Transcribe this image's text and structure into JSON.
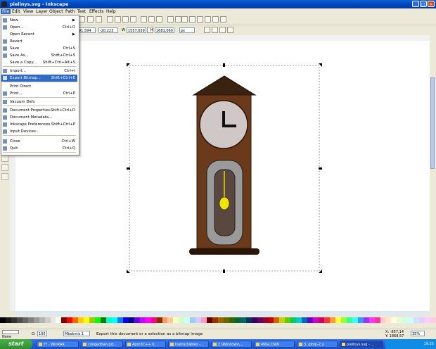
{
  "window": {
    "title": "pielinys.svg - Inkscape",
    "min": "_",
    "max": "□",
    "close": "×"
  },
  "menubar": [
    "File",
    "Edit",
    "View",
    "Layer",
    "Object",
    "Path",
    "Text",
    "Effects",
    "Help"
  ],
  "toolbar2": {
    "x_value": "91,594",
    "y_label": "",
    "y_value": "-20,223",
    "w_label": "W",
    "w_value": "1557,659",
    "h_label": "H",
    "h_value": "1681,060",
    "unit": "px"
  },
  "file_menu": [
    {
      "label": "New",
      "shortcut": "▶",
      "icon": "new-icon"
    },
    {
      "label": "Open...",
      "shortcut": "Ctrl+O",
      "icon": "open-icon"
    },
    {
      "label": "Open Recent",
      "shortcut": "▶",
      "icon": ""
    },
    {
      "label": "Revert",
      "shortcut": "",
      "icon": "revert-icon"
    },
    {
      "label": "Save",
      "shortcut": "Ctrl+S",
      "icon": "save-icon"
    },
    {
      "label": "Save As...",
      "shortcut": "Shift+Ctrl+S",
      "icon": "save-as-icon"
    },
    {
      "label": "Save a Copy...",
      "shortcut": "Shift+Ctrl+Alt+S",
      "icon": ""
    },
    {
      "label": "Import...",
      "shortcut": "Ctrl+I",
      "icon": "import-icon"
    },
    {
      "label": "Export Bitmap...",
      "shortcut": "Shift+Ctrl+E",
      "icon": "export-icon"
    },
    {
      "label": "Print Direct",
      "shortcut": "",
      "icon": ""
    },
    {
      "label": "Print...",
      "shortcut": "Ctrl+P",
      "icon": "print-icon"
    },
    {
      "label": "Vacuum Defs",
      "shortcut": "",
      "icon": "vacuum-icon"
    },
    {
      "label": "Document Properties...",
      "shortcut": "Shift+Ctrl+D",
      "icon": "doc-properties-icon"
    },
    {
      "label": "Document Metadata...",
      "shortcut": "",
      "icon": "metadata-icon"
    },
    {
      "label": "Inkscape Preferences...",
      "shortcut": "Shift+Ctrl+P",
      "icon": "preferences-icon"
    },
    {
      "label": "Input Devices...",
      "shortcut": "",
      "icon": "input-devices-icon"
    },
    {
      "label": "Close",
      "shortcut": "Ctrl+W",
      "icon": "close-icon"
    },
    {
      "label": "Quit",
      "shortcut": "Ctrl+Q",
      "icon": "quit-icon"
    }
  ],
  "status": {
    "opacity_label": "O:",
    "opacity": "100",
    "layer": "Mbokmis 1",
    "message": "Export this document or a selection as a bitmap image",
    "coords_x": "X: -857,14",
    "coords_y": "Y: 1868,57",
    "zoom": "35%",
    "none_label": "None"
  },
  "taskbar": {
    "start": "start",
    "tasks": [
      "?? - WinRAR",
      "congedhan.pd...",
      "Apro3C++ 0...",
      "Instructables -...",
      "Z:\\Windows\\...",
      "4NGLCNIN",
      "3. gimp-2.2",
      "pielinys.svg - ..."
    ],
    "clock": "19:25"
  },
  "palette": [
    "#000000",
    "#1a1a1a",
    "#333333",
    "#4d4d4d",
    "#666666",
    "#808080",
    "#999999",
    "#b3b3b3",
    "#cccccc",
    "#e6e6e6",
    "#ffffff",
    "#800000",
    "#ff0000",
    "#ff6600",
    "#ffcc00",
    "#ffff00",
    "#99cc00",
    "#00ff00",
    "#008000",
    "#00ffcc",
    "#00ffff",
    "#0080ff",
    "#0000ff",
    "#000080",
    "#6600ff",
    "#cc00ff",
    "#ff00ff",
    "#ff0080",
    "#803300",
    "#ff9966",
    "#ffcc99",
    "#ffffcc",
    "#ccffcc",
    "#ccffff",
    "#99ccff",
    "#ccccff",
    "#ff99cc",
    "#660000",
    "#993300",
    "#996600",
    "#666600",
    "#336600",
    "#006633",
    "#006666",
    "#003366",
    "#330066",
    "#660066",
    "#990033",
    "#cc0000",
    "#cc6600",
    "#cccc00",
    "#66cc00",
    "#00cc66",
    "#00cccc",
    "#0066cc",
    "#6600cc",
    "#cc00cc",
    "#cc0066",
    "#ff3333",
    "#ff9933",
    "#ffff33",
    "#99ff33",
    "#33ff99",
    "#33ffff",
    "#3399ff",
    "#9933ff",
    "#ff33ff",
    "#ff3399",
    "#ffcccc",
    "#ffe5cc",
    "#ffffe5",
    "#e5ffcc",
    "#ccffe5",
    "#ccffff",
    "#cce5ff",
    "#e5ccff",
    "#ffccff",
    "#ffcce5"
  ]
}
